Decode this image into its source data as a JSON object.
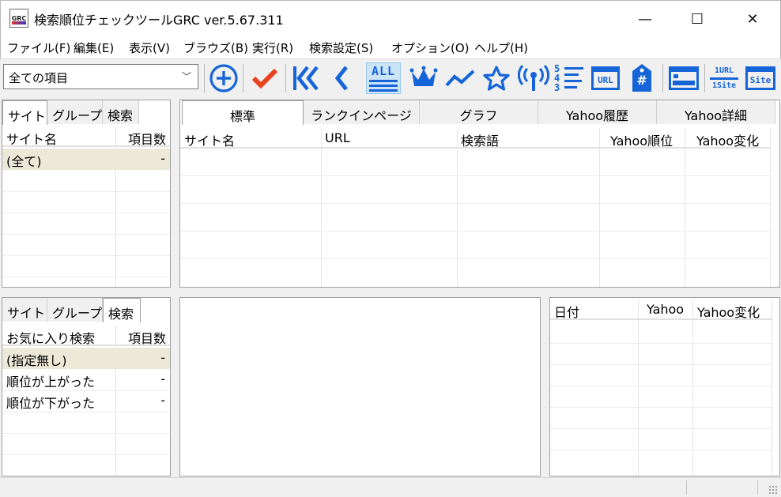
{
  "window": {
    "title": "検索順位チェックツールGRC  ver.5.67.311",
    "icon_label": "GRC",
    "buttons": {
      "minimize": "—",
      "maximize": "☐",
      "close": "✕"
    }
  },
  "menu": [
    "ファイル(F)",
    "編集(E)",
    "表示(V)",
    "ブラウズ(B)",
    "実行(R)",
    "検索設定(S)",
    "オプション(O)",
    "ヘルプ(H)"
  ],
  "toolbar": {
    "scope_select": {
      "value": "全ての項目"
    },
    "icons": {
      "add": "plus-circle-icon",
      "check": "check-icon",
      "first": "double-chevron-left-icon",
      "prev": "chevron-left-icon",
      "all": "all-filter-icon",
      "top": "crown-icon",
      "trend": "trend-line-icon",
      "fav": "star-icon",
      "signal": "broadcast-icon",
      "rank": "ranked-list-icon",
      "url": "url-window-icon",
      "tag": "hashtag-tag-icon",
      "layout": "window-layout-icon",
      "onesite": "one-url-one-site-icon",
      "site": "site-window-icon"
    },
    "text": {
      "all": "ALL",
      "url": "URL",
      "hash": "#",
      "one_url": "1URL",
      "one_site": "1Site",
      "site": "Site",
      "rank_digits": [
        "5",
        "4",
        "3"
      ]
    },
    "colors": {
      "accent": "#1565d8",
      "check": "#e8431e",
      "active_bg": "#cce4f7"
    }
  },
  "top_left": {
    "tabs": [
      "サイト",
      "グループ",
      "検索"
    ],
    "selected_tab": "サイト",
    "columns": [
      "サイト名",
      "項目数"
    ],
    "rows": [
      {
        "name": "(全て)",
        "count": "-"
      }
    ]
  },
  "top_right": {
    "tabs": [
      "標準",
      "ランクインページ",
      "グラフ",
      "Yahoo履歴",
      "Yahoo詳細"
    ],
    "selected_tab": "標準",
    "columns": [
      "サイト名",
      "URL",
      "検索語",
      "Yahoo順位",
      "Yahoo変化"
    ]
  },
  "bottom_left": {
    "tabs": [
      "サイト",
      "グループ",
      "検索"
    ],
    "selected_tab": "検索",
    "columns": [
      "お気に入り検索",
      "項目数"
    ],
    "rows": [
      {
        "name": "(指定無し)",
        "count": "-"
      },
      {
        "name": "順位が上がった",
        "count": "-"
      },
      {
        "name": "順位が下がった",
        "count": "-"
      }
    ]
  },
  "bottom_right": {
    "columns": [
      "日付",
      "Yahoo",
      "Yahoo変化"
    ]
  }
}
